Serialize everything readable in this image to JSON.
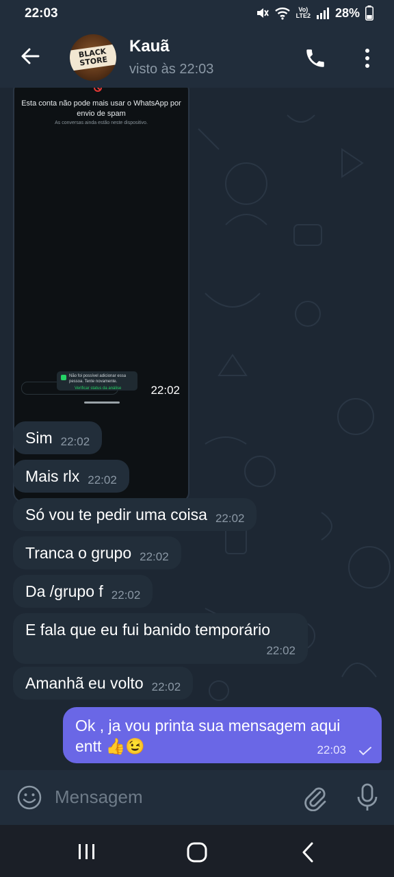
{
  "status_bar": {
    "time": "22:03",
    "battery": "28%",
    "network": "LTE2",
    "volte": "Vo)"
  },
  "header": {
    "contact_name": "Kauã",
    "last_seen": "visto às 22:03",
    "avatar_text": "BLACK STORE"
  },
  "media_message": {
    "screenshot_title": "Esta conta não pode mais usar o WhatsApp por envio de spam",
    "screenshot_subtitle": "As conversas ainda estão neste dispositivo.",
    "toast_text": "Não foi possível adicionar essa pessoa. Tente novamente.",
    "toast_link": "Verificar status da análise",
    "time": "22:02"
  },
  "messages": [
    {
      "text": "Sim",
      "time": "22:02"
    },
    {
      "text": "Mais rlx",
      "time": "22:02"
    },
    {
      "text": "Só vou te pedir uma coisa",
      "time": "22:02"
    },
    {
      "text": "Tranca o grupo",
      "time": "22:02"
    },
    {
      "text": "Da /grupo f",
      "time": "22:02"
    },
    {
      "text": "E fala que eu fui banido temporário",
      "time": "22:02"
    },
    {
      "text": "Amanhã eu volto",
      "time": "22:02"
    }
  ],
  "outgoing": {
    "text": "Ok , ja vou printa sua mensagem aqui entt 👍😉",
    "time": "22:03"
  },
  "input": {
    "placeholder": "Mensagem"
  },
  "colors": {
    "outgoing_bubble": "#6a67e6",
    "incoming_bubble": "#222e3a",
    "chat_bg": "#1d2733",
    "header_bg": "#212d3b"
  }
}
